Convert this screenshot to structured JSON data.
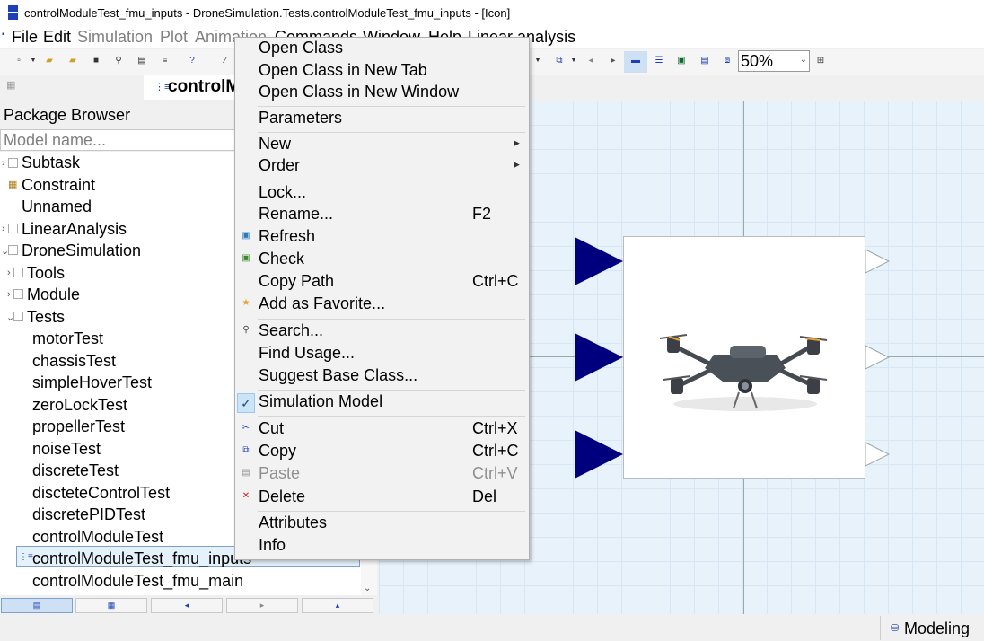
{
  "window": {
    "title": "controlModuleTest_fmu_inputs - DroneSimulation.Tests.controlModuleTest_fmu_inputs  - [Icon]"
  },
  "menubar": {
    "items": [
      "File",
      "Edit",
      "Simulation",
      "Plot",
      "Animation",
      "Commands",
      "Window",
      "Help",
      "Linear analysis"
    ]
  },
  "toolbar": {
    "zoom_value": "50%"
  },
  "tab": {
    "label": "controlModuleTest_fmu_inputs"
  },
  "package_browser": {
    "title": "Package Browser",
    "search_placeholder": "Model name...",
    "tree": [
      "Subtask",
      "Constraint",
      "Unnamed",
      "LinearAnalysis",
      "DroneSimulation",
      "Tools",
      "Module",
      "Tests",
      "motorTest",
      "chassisTest",
      "simpleHoverTest",
      "zeroLockTest",
      "propellerTest",
      "noiseTest",
      "discreteTest",
      "discteteControlTest",
      "discretePIDTest",
      "controlModuleTest",
      "controlModuleTest_fmu_inputs",
      "controlModuleTest_fmu_main"
    ]
  },
  "context_menu": {
    "items": [
      {
        "label": "Open Class",
        "shortcut": ""
      },
      {
        "label": "Open Class in New Tab",
        "shortcut": ""
      },
      {
        "label": "Open Class in New Window",
        "shortcut": ""
      },
      {
        "label": "Parameters",
        "shortcut": ""
      },
      {
        "label": "New",
        "shortcut": ""
      },
      {
        "label": "Order",
        "shortcut": ""
      },
      {
        "label": "Lock...",
        "shortcut": ""
      },
      {
        "label": "Rename...",
        "shortcut": "F2"
      },
      {
        "label": "Refresh",
        "shortcut": ""
      },
      {
        "label": "Check",
        "shortcut": ""
      },
      {
        "label": "Copy Path",
        "shortcut": "Ctrl+C"
      },
      {
        "label": "Add as Favorite...",
        "shortcut": ""
      },
      {
        "label": "Search...",
        "shortcut": ""
      },
      {
        "label": "Find Usage...",
        "shortcut": ""
      },
      {
        "label": "Suggest Base Class...",
        "shortcut": ""
      },
      {
        "label": "Simulation Model",
        "shortcut": "",
        "checked": true
      },
      {
        "label": "Cut",
        "shortcut": "Ctrl+X"
      },
      {
        "label": "Copy",
        "shortcut": "Ctrl+C"
      },
      {
        "label": "Paste",
        "shortcut": "Ctrl+V",
        "disabled": true
      },
      {
        "label": "Delete",
        "shortcut": "Del"
      },
      {
        "label": "Attributes",
        "shortcut": ""
      },
      {
        "label": "Info",
        "shortcut": ""
      }
    ]
  },
  "diagram": {
    "input_color": "#00007f",
    "output_color": "#ffffff"
  },
  "statusbar": {
    "mode": "Modeling"
  }
}
